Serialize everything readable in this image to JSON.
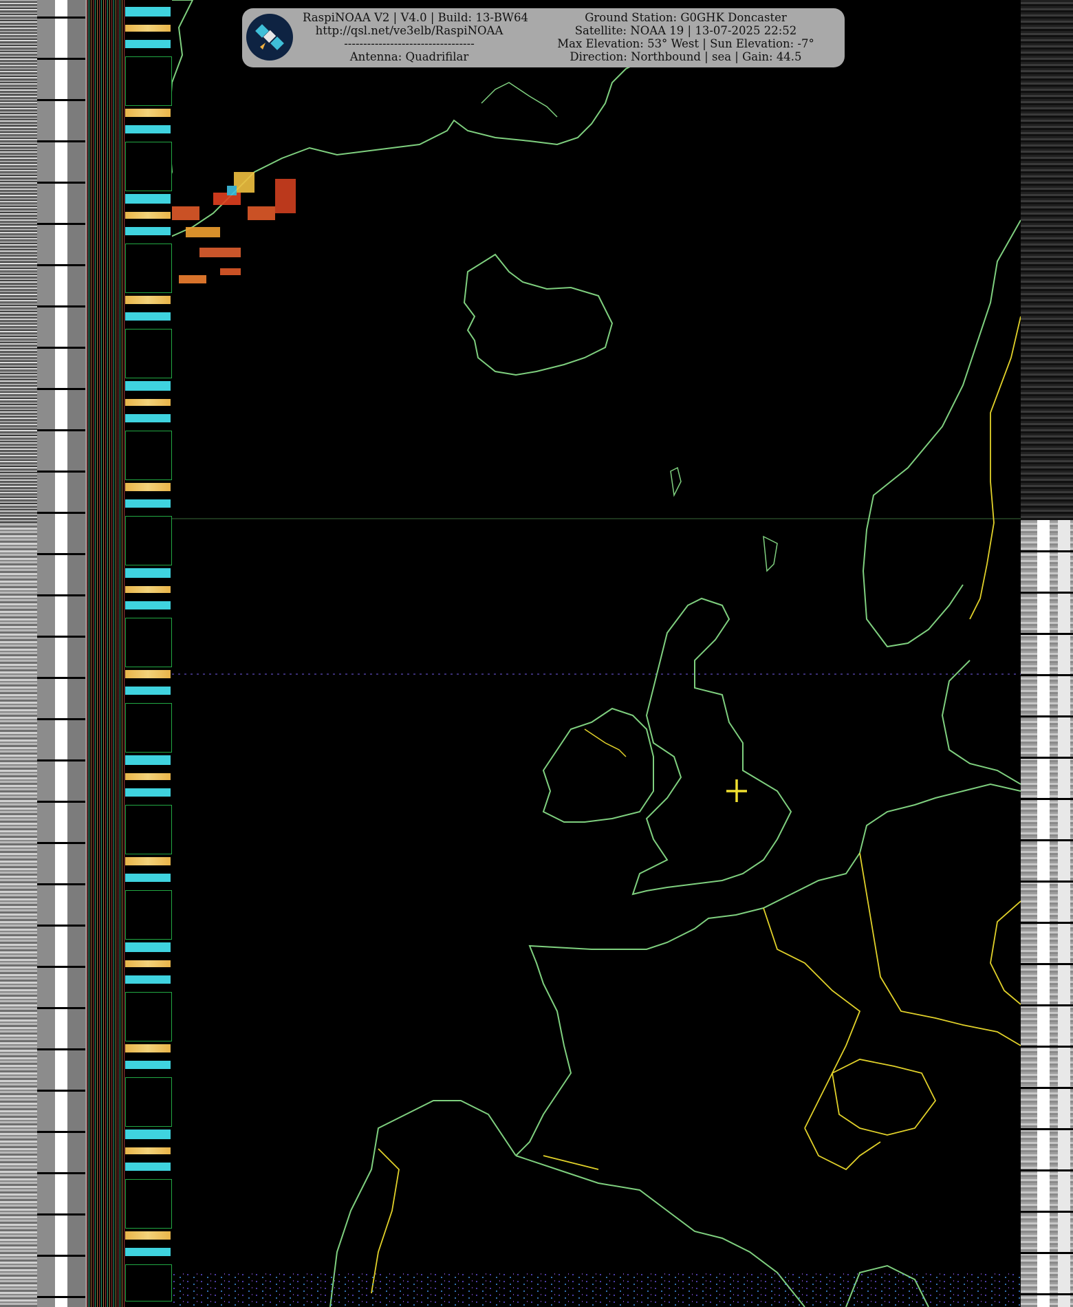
{
  "header": {
    "left_lines": [
      "RaspiNOAA V2 | V4.0 | Build: 13-BW64",
      "http://qsl.net/ve3elb/RaspiNOAA",
      "----------------------------------",
      "Antenna: Quadrifilar"
    ],
    "right_lines": [
      "Ground Station: G0GHK Doncaster",
      "Satellite: NOAA 19 | 13-07-2025 22:52",
      "Max Elevation: 53° West | Sun Elevation: -7°",
      "Direction: Northbound | sea | Gain: 44.5"
    ]
  },
  "colors": {
    "coastline": "#7fd07f",
    "borders": "#e2d22a",
    "ground_station_marker": "#f0e030",
    "header_panel": "#a9a9a9"
  },
  "icons": {
    "logo": "satellite-icon",
    "station_marker": "crosshair-icon"
  }
}
